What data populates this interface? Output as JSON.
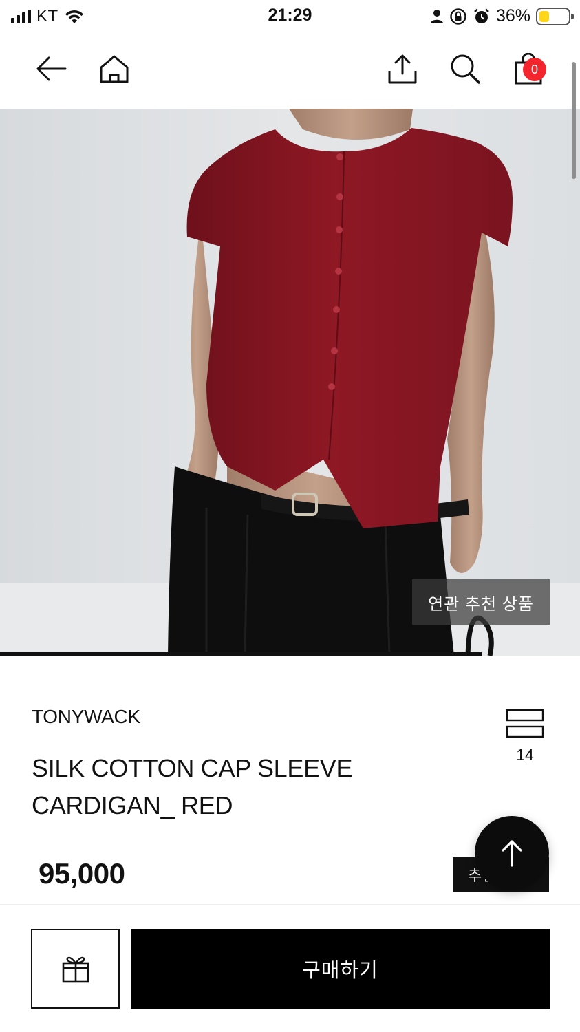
{
  "status_bar": {
    "carrier": "KT",
    "time": "21:29",
    "battery_percent": "36%",
    "battery_level": 0.36,
    "icons": [
      "signal-icon",
      "wifi-icon",
      "person-icon",
      "orientation-lock-icon",
      "alarm-icon",
      "battery-icon"
    ]
  },
  "nav": {
    "icons": [
      "back-arrow-icon",
      "home-icon",
      "share-icon",
      "search-icon",
      "cart-icon"
    ],
    "cart_count": "0",
    "badge_color": "#f3262d"
  },
  "hero": {
    "related_label": "연관 추천 상품",
    "image_progress": 0.83
  },
  "product": {
    "brand": "TONYWACK",
    "title": "SILK COTTON CAP SLEEVE CARDIGAN_ RED",
    "wish_count": "14",
    "price": "95,000",
    "recommend_button_label": "추천"
  },
  "bottom_bar": {
    "gift_icon": "gift-icon",
    "buy_label": "구매하기"
  },
  "colors": {
    "accent": "#000000",
    "garment": "#8e1824",
    "battery": "#ffd51a"
  }
}
